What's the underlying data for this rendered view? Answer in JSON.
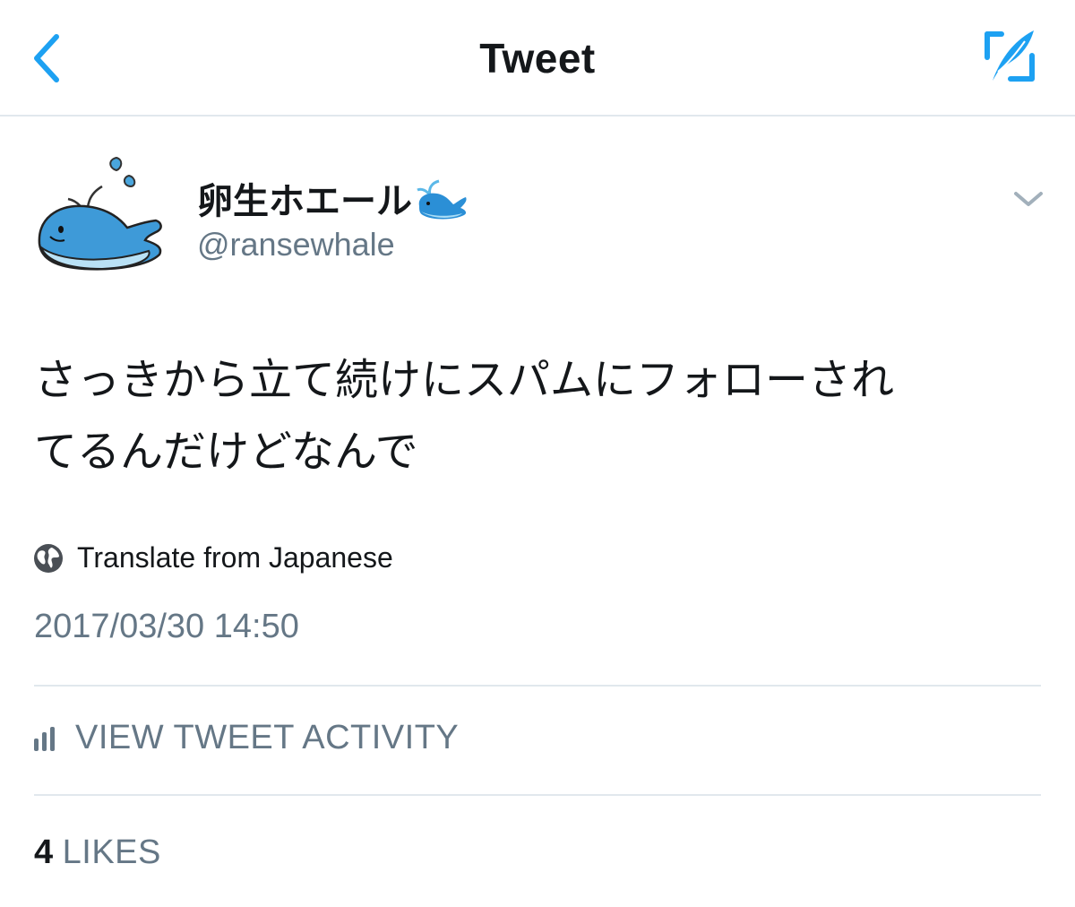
{
  "nav": {
    "title": "Tweet",
    "back_icon": "chevron-left-icon",
    "compose_icon": "compose-tweet-icon",
    "accent_color": "#1da1f2"
  },
  "author": {
    "display_name": "卵生ホエール",
    "name_emoji": "spouting-whale-emoji",
    "handle": "@ransewhale",
    "avatar": "whale-avatar"
  },
  "tweet": {
    "text_line1": "さっきから立て続けにスパムにフォローされ",
    "text_line2": "てるんだけどなんで",
    "translate_label": "Translate from Japanese",
    "timestamp": "2017/03/30 14:50"
  },
  "activity": {
    "label": "VIEW TWEET ACTIVITY"
  },
  "likes": {
    "count": "4",
    "label": "LIKES"
  }
}
